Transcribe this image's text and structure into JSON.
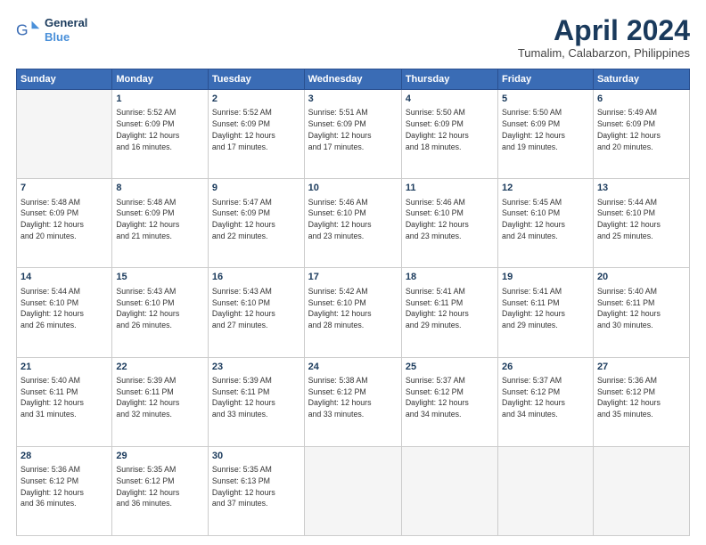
{
  "logo": {
    "line1": "General",
    "line2": "Blue",
    "icon": "🔷"
  },
  "title": "April 2024",
  "location": "Tumalim, Calabarzon, Philippines",
  "weekdays": [
    "Sunday",
    "Monday",
    "Tuesday",
    "Wednesday",
    "Thursday",
    "Friday",
    "Saturday"
  ],
  "weeks": [
    [
      {
        "num": "",
        "info": ""
      },
      {
        "num": "1",
        "info": "Sunrise: 5:52 AM\nSunset: 6:09 PM\nDaylight: 12 hours\nand 16 minutes."
      },
      {
        "num": "2",
        "info": "Sunrise: 5:52 AM\nSunset: 6:09 PM\nDaylight: 12 hours\nand 17 minutes."
      },
      {
        "num": "3",
        "info": "Sunrise: 5:51 AM\nSunset: 6:09 PM\nDaylight: 12 hours\nand 17 minutes."
      },
      {
        "num": "4",
        "info": "Sunrise: 5:50 AM\nSunset: 6:09 PM\nDaylight: 12 hours\nand 18 minutes."
      },
      {
        "num": "5",
        "info": "Sunrise: 5:50 AM\nSunset: 6:09 PM\nDaylight: 12 hours\nand 19 minutes."
      },
      {
        "num": "6",
        "info": "Sunrise: 5:49 AM\nSunset: 6:09 PM\nDaylight: 12 hours\nand 20 minutes."
      }
    ],
    [
      {
        "num": "7",
        "info": "Sunrise: 5:48 AM\nSunset: 6:09 PM\nDaylight: 12 hours\nand 20 minutes."
      },
      {
        "num": "8",
        "info": "Sunrise: 5:48 AM\nSunset: 6:09 PM\nDaylight: 12 hours\nand 21 minutes."
      },
      {
        "num": "9",
        "info": "Sunrise: 5:47 AM\nSunset: 6:09 PM\nDaylight: 12 hours\nand 22 minutes."
      },
      {
        "num": "10",
        "info": "Sunrise: 5:46 AM\nSunset: 6:10 PM\nDaylight: 12 hours\nand 23 minutes."
      },
      {
        "num": "11",
        "info": "Sunrise: 5:46 AM\nSunset: 6:10 PM\nDaylight: 12 hours\nand 23 minutes."
      },
      {
        "num": "12",
        "info": "Sunrise: 5:45 AM\nSunset: 6:10 PM\nDaylight: 12 hours\nand 24 minutes."
      },
      {
        "num": "13",
        "info": "Sunrise: 5:44 AM\nSunset: 6:10 PM\nDaylight: 12 hours\nand 25 minutes."
      }
    ],
    [
      {
        "num": "14",
        "info": "Sunrise: 5:44 AM\nSunset: 6:10 PM\nDaylight: 12 hours\nand 26 minutes."
      },
      {
        "num": "15",
        "info": "Sunrise: 5:43 AM\nSunset: 6:10 PM\nDaylight: 12 hours\nand 26 minutes."
      },
      {
        "num": "16",
        "info": "Sunrise: 5:43 AM\nSunset: 6:10 PM\nDaylight: 12 hours\nand 27 minutes."
      },
      {
        "num": "17",
        "info": "Sunrise: 5:42 AM\nSunset: 6:10 PM\nDaylight: 12 hours\nand 28 minutes."
      },
      {
        "num": "18",
        "info": "Sunrise: 5:41 AM\nSunset: 6:11 PM\nDaylight: 12 hours\nand 29 minutes."
      },
      {
        "num": "19",
        "info": "Sunrise: 5:41 AM\nSunset: 6:11 PM\nDaylight: 12 hours\nand 29 minutes."
      },
      {
        "num": "20",
        "info": "Sunrise: 5:40 AM\nSunset: 6:11 PM\nDaylight: 12 hours\nand 30 minutes."
      }
    ],
    [
      {
        "num": "21",
        "info": "Sunrise: 5:40 AM\nSunset: 6:11 PM\nDaylight: 12 hours\nand 31 minutes."
      },
      {
        "num": "22",
        "info": "Sunrise: 5:39 AM\nSunset: 6:11 PM\nDaylight: 12 hours\nand 32 minutes."
      },
      {
        "num": "23",
        "info": "Sunrise: 5:39 AM\nSunset: 6:11 PM\nDaylight: 12 hours\nand 33 minutes."
      },
      {
        "num": "24",
        "info": "Sunrise: 5:38 AM\nSunset: 6:12 PM\nDaylight: 12 hours\nand 33 minutes."
      },
      {
        "num": "25",
        "info": "Sunrise: 5:37 AM\nSunset: 6:12 PM\nDaylight: 12 hours\nand 34 minutes."
      },
      {
        "num": "26",
        "info": "Sunrise: 5:37 AM\nSunset: 6:12 PM\nDaylight: 12 hours\nand 34 minutes."
      },
      {
        "num": "27",
        "info": "Sunrise: 5:36 AM\nSunset: 6:12 PM\nDaylight: 12 hours\nand 35 minutes."
      }
    ],
    [
      {
        "num": "28",
        "info": "Sunrise: 5:36 AM\nSunset: 6:12 PM\nDaylight: 12 hours\nand 36 minutes."
      },
      {
        "num": "29",
        "info": "Sunrise: 5:35 AM\nSunset: 6:12 PM\nDaylight: 12 hours\nand 36 minutes."
      },
      {
        "num": "30",
        "info": "Sunrise: 5:35 AM\nSunset: 6:13 PM\nDaylight: 12 hours\nand 37 minutes."
      },
      {
        "num": "",
        "info": ""
      },
      {
        "num": "",
        "info": ""
      },
      {
        "num": "",
        "info": ""
      },
      {
        "num": "",
        "info": ""
      }
    ]
  ]
}
